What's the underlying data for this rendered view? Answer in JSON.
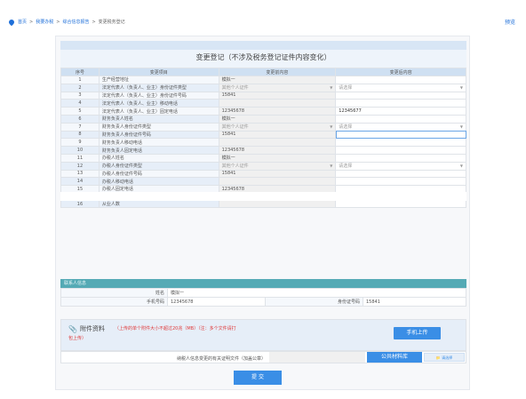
{
  "breadcrumb": {
    "items": [
      "首页",
      "我要办税",
      "综合信息报告",
      "变更税务登记"
    ],
    "separator": ">"
  },
  "header": {
    "preview_label": "预览"
  },
  "form": {
    "title": "变更登记（不涉及税务登记证件内容变化）",
    "columns": [
      "序号",
      "变更项目",
      "变更前内容",
      "变更后内容"
    ],
    "rows": [
      {
        "no": "1",
        "item": "生产经营地址",
        "before": "模拟一",
        "after": "",
        "after_type": "text"
      },
      {
        "no": "2",
        "item": "法定代表人（负责人、业主）身份证件类型",
        "before": "其他个人证件",
        "before_type": "select",
        "after": "请选择",
        "after_type": "select"
      },
      {
        "no": "3",
        "item": "法定代表人（负责人、业主）身份证件号码",
        "before": "15841",
        "after": "",
        "after_type": "text"
      },
      {
        "no": "4",
        "item": "法定代表人（负责人、业主）移动电话",
        "before": "",
        "after": "",
        "after_type": "text"
      },
      {
        "no": "5",
        "item": "法定代表人（负责人、业主）固定电话",
        "before": "12345678",
        "after": "12345677",
        "after_type": "text"
      },
      {
        "no": "6",
        "item": "财务负责人姓名",
        "before": "模拟一",
        "after": "",
        "after_type": "text"
      },
      {
        "no": "7",
        "item": "财务负责人身份证件类型",
        "before": "其他个人证件",
        "before_type": "select",
        "after": "请选择",
        "after_type": "select"
      },
      {
        "no": "8",
        "item": "财务负责人身份证件号码",
        "before": "15841",
        "after": "",
        "after_type": "text",
        "focused": true
      },
      {
        "no": "9",
        "item": "财务负责人移动电话",
        "before": "",
        "after": "",
        "after_type": "text"
      },
      {
        "no": "10",
        "item": "财务负责人固定电话",
        "before": "12345678",
        "after": "",
        "after_type": "text"
      },
      {
        "no": "11",
        "item": "办税人姓名",
        "before": "模拟一",
        "after": "",
        "after_type": "text"
      },
      {
        "no": "12",
        "item": "办税人身份证件类型",
        "before": "其他个人证件",
        "before_type": "select",
        "after": "请选择",
        "after_type": "select"
      },
      {
        "no": "13",
        "item": "办税人身份证件号码",
        "before": "15841",
        "after": "",
        "after_type": "text"
      },
      {
        "no": "14",
        "item": "办税人移动电话",
        "before": "",
        "after": "",
        "after_type": "text"
      },
      {
        "no": "15",
        "item": "办税人固定电话",
        "before": "12345678",
        "after": "",
        "after_type": "text"
      },
      {
        "no": "16",
        "item": "从业人数",
        "before": "",
        "after": "",
        "after_type": "text"
      }
    ]
  },
  "contact": {
    "header": "联系人信息",
    "name_label": "姓名",
    "name_value": "模拟一",
    "phone_label": "手机号码",
    "phone_value": "12345678",
    "id_label": "身份证号码",
    "id_value": "15841"
  },
  "attachment": {
    "title": "附件资料",
    "note_line1": "（上传的单个附件大小不超过20兆（MB）（注：多个文件请打",
    "note_line2": "包上传）",
    "mobile_upload_label": "手机上传",
    "doc_label": "纳税人信息变更的有关证明文件（加盖公章）",
    "public_lib_label": "公共材料库",
    "pick_label": "请选择"
  },
  "submit_label": "提 交",
  "colors": {
    "accent": "#3a8ee6",
    "header_bg": "#cfe0f2",
    "contact_header": "#55aab5",
    "note_red": "#e03a3a"
  }
}
